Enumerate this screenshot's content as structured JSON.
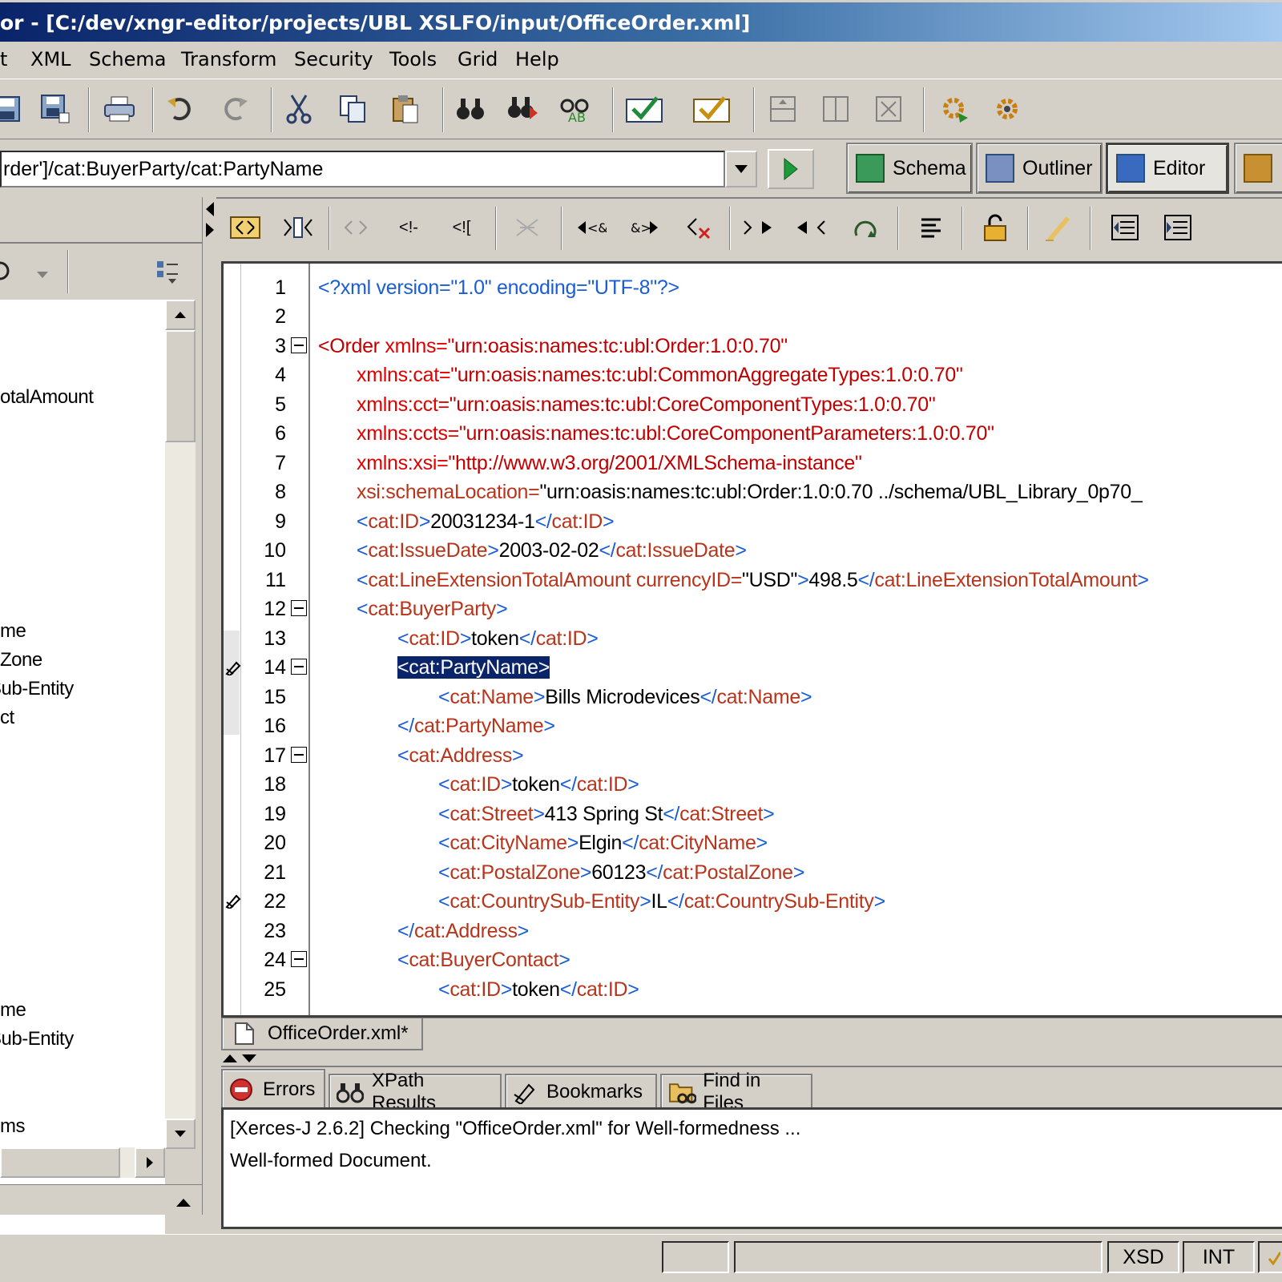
{
  "window": {
    "title": "or - [C:/dev/xngr-editor/projects/UBL XSLFO/input/OfficeOrder.xml]"
  },
  "menu": [
    "t",
    "XML",
    "Schema",
    "Transform",
    "Security",
    "Tools",
    "Grid",
    "Help"
  ],
  "xpath": {
    "value": "rder']/cat:BuyerParty/cat:PartyName"
  },
  "views": {
    "schema": "Schema",
    "outliner": "Outliner",
    "editor": "Editor"
  },
  "tree": {
    "items": [
      "otalAmount",
      "me",
      "Zone",
      "Sub-Entity",
      "ct",
      "me",
      "Sub-Entity",
      "ms"
    ]
  },
  "editor": {
    "lines": [
      {
        "n": "1"
      },
      {
        "n": "2"
      },
      {
        "n": "3"
      },
      {
        "n": "4"
      },
      {
        "n": "5"
      },
      {
        "n": "6"
      },
      {
        "n": "7"
      },
      {
        "n": "8"
      },
      {
        "n": "9"
      },
      {
        "n": "10"
      },
      {
        "n": "11"
      },
      {
        "n": "12"
      },
      {
        "n": "13"
      },
      {
        "n": "14"
      },
      {
        "n": "15"
      },
      {
        "n": "16"
      },
      {
        "n": "17"
      },
      {
        "n": "18"
      },
      {
        "n": "19"
      },
      {
        "n": "20"
      },
      {
        "n": "21"
      },
      {
        "n": "22"
      },
      {
        "n": "23"
      },
      {
        "n": "24"
      },
      {
        "n": "25"
      }
    ],
    "code": {
      "l1": "<?xml version=\"1.0\" encoding=\"UTF-8\"?>",
      "l3_tag": "<Order",
      "l3_attr": " xmlns=",
      "l3_val": "\"urn:oasis:names:tc:ubl:Order:1.0:0.70\"",
      "l4_attr": "xmlns:cat=",
      "l4_val": "\"urn:oasis:names:tc:ubl:CommonAggregateTypes:1.0:0.70\"",
      "l5_attr": "xmlns:cct=",
      "l5_val": "\"urn:oasis:names:tc:ubl:CoreComponentTypes:1.0:0.70\"",
      "l6_attr": "xmlns:ccts=",
      "l6_val": "\"urn:oasis:names:tc:ubl:CoreComponentParameters:1.0:0.70\"",
      "l7_attr": "xmlns:xsi=",
      "l7_val": "\"http://www.w3.org/2001/XMLSchema-instance\"",
      "l8_attr": "xsi:schemaLocation=",
      "l8_val": "\"urn:oasis:names:tc:ubl:Order:1.0:0.70 ../schema/UBL_Library_0p70_",
      "l9_open": "cat:ID",
      "l9_text": "20031234-1",
      "l9_close": "cat:ID",
      "l10_open": "cat:IssueDate",
      "l10_text": "2003-02-02",
      "l10_close": "cat:IssueDate",
      "l11_open": "cat:LineExtensionTotalAmount",
      "l11_attr": " currencyID=",
      "l11_val": "\"USD\"",
      "l11_text": "498.5",
      "l11_close": "cat:LineExtensionTotalAmount",
      "l12_open": "cat:BuyerParty",
      "l13_open": "cat:ID",
      "l13_text": "token",
      "l13_close": "cat:ID",
      "l14_sel": "<cat:PartyName>",
      "l15_open": "cat:Name",
      "l15_text": "Bills Microdevices",
      "l15_close": "cat:Name",
      "l16_close": "cat:PartyName",
      "l17_open": "cat:Address",
      "l18_open": "cat:ID",
      "l18_text": "token",
      "l18_close": "cat:ID",
      "l19_open": "cat:Street",
      "l19_text": "413 Spring St",
      "l19_close": "cat:Street",
      "l20_open": "cat:CityName",
      "l20_text": "Elgin",
      "l20_close": "cat:CityName",
      "l21_open": "cat:PostalZone",
      "l21_text": "60123",
      "l21_close": "cat:PostalZone",
      "l22_open": "cat:CountrySub-Entity",
      "l22_text": "IL",
      "l22_close": "cat:CountrySub-Entity",
      "l23_close": "cat:Address",
      "l24_open": "cat:BuyerContact",
      "l25_open": "cat:ID",
      "l25_text": "token",
      "l25_close": "cat:ID"
    }
  },
  "file_tab": "OfficeOrder.xml*",
  "bottom_tabs": {
    "errors": "Errors",
    "xpath": "XPath Results",
    "bookmarks": "Bookmarks",
    "find": "Find in Files"
  },
  "output": {
    "line1": "[Xerces-J 2.6.2] Checking \"OfficeOrder.xml\" for Well-formedness ...",
    "line2": "Well-formed Document."
  },
  "status": {
    "xsd": "XSD",
    "int": "INT"
  },
  "colors": {
    "tag": "#c00000",
    "element_bracket": "#1a5dd4",
    "element_name": "#b8341b",
    "selection": "#0a246a"
  }
}
